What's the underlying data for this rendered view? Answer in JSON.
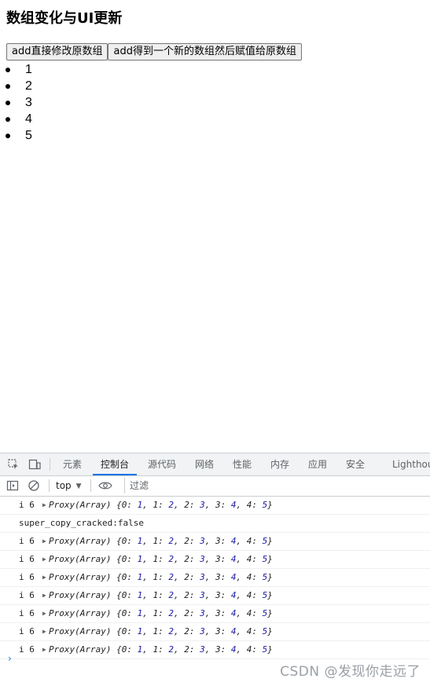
{
  "page": {
    "title": "数组变化与UI更新",
    "buttons": [
      "add直接修改原数组",
      "add得到一个新的数组然后赋值给原数组"
    ],
    "list_items": [
      "1",
      "2",
      "3",
      "4",
      "5"
    ]
  },
  "devtools": {
    "tabs": [
      "元素",
      "控制台",
      "源代码",
      "网络",
      "性能",
      "内存",
      "应用",
      "安全",
      "Lighthou"
    ],
    "active_tab": "控制台",
    "context_selector": "top",
    "filter_placeholder": "过滤",
    "console_rows": [
      {
        "type": "proxy",
        "lead": "i 6",
        "text_prefix": "Proxy(Array) {0: ",
        "entries": [
          [
            "0",
            "1"
          ],
          [
            "1",
            "2"
          ],
          [
            "2",
            "3"
          ],
          [
            "3",
            "4"
          ],
          [
            "4",
            "5"
          ]
        ]
      },
      {
        "type": "text",
        "text": "super_copy_cracked:false"
      },
      {
        "type": "proxy",
        "lead": "i 6"
      },
      {
        "type": "proxy",
        "lead": "i 6"
      },
      {
        "type": "proxy",
        "lead": "i 6"
      },
      {
        "type": "proxy",
        "lead": "i 6"
      },
      {
        "type": "proxy",
        "lead": "i 6"
      },
      {
        "type": "proxy",
        "lead": "i 6"
      },
      {
        "type": "proxy",
        "lead": "i 6"
      }
    ],
    "proxy_text": "Proxy(Array) {0: 1, 1: 2, 2: 3, 3: 4, 4: 5}",
    "prompt_symbol": "›"
  },
  "watermark": "CSDN @发现你走远了",
  "colors": {
    "accent": "#1a73e8",
    "number": "#1a1aa6",
    "toolbar_bg": "#f1f3f4"
  }
}
